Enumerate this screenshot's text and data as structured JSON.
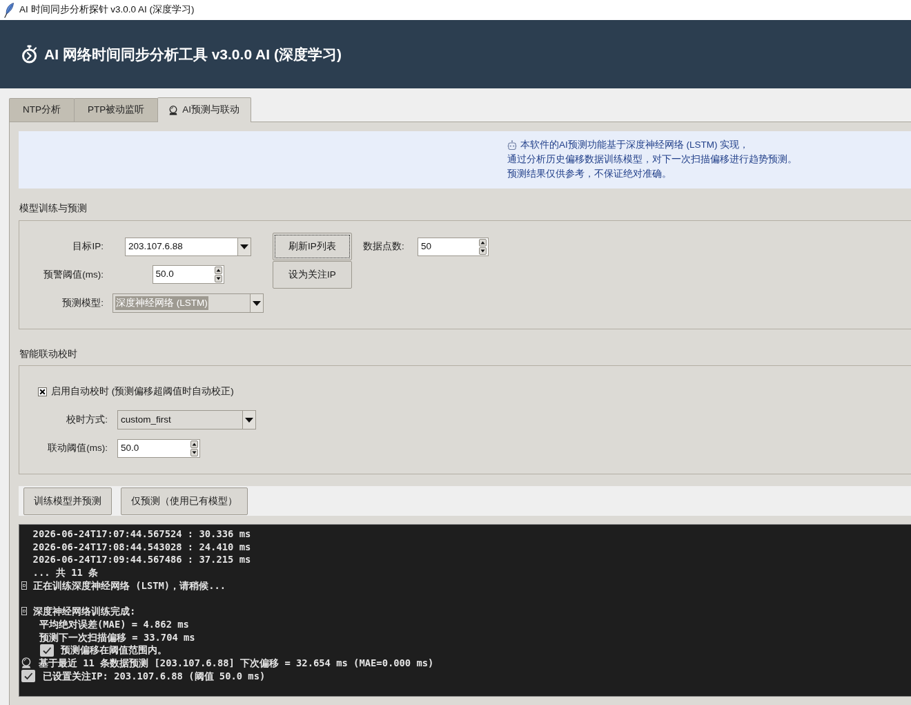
{
  "window": {
    "title": "AI 时间同步分析探针 v3.0.0 AI (深度学习)"
  },
  "header": {
    "title": "AI 网络时间同步分析工具 v3.0.0 AI (深度学习)"
  },
  "tabs": [
    {
      "label": "NTP分析",
      "kind": "plain",
      "selected": false
    },
    {
      "label": "PTP被动监听",
      "kind": "plain",
      "selected": false
    },
    {
      "label": "AI预测与联动",
      "kind": "forecast",
      "selected": true
    }
  ],
  "notice": {
    "lines": [
      "本软件的AI预测功能基于深度神经网络 (LSTM) 实现，",
      "通过分析历史偏移数据训练模型，对下一次扫描偏移进行趋势预测。",
      "预测结果仅供参考，不保证绝对准确。"
    ]
  },
  "model_section": {
    "title": "模型训练与预测",
    "target_ip": {
      "label": "目标IP:",
      "value": "203.107.6.88",
      "editable": true,
      "highlighted": false
    },
    "buttons": [
      {
        "label": "刷新IP列表",
        "focused": true
      },
      {
        "label": "设为关注IP",
        "focused": false
      }
    ],
    "data_points": {
      "label": "数据点数:",
      "value": "50"
    },
    "alert_threshold": {
      "label": "预警阈值(ms):",
      "value": "50.0"
    },
    "model": {
      "label": "预测模型:",
      "value": "深度神经网络 (LSTM)",
      "editable": false,
      "highlighted": true
    }
  },
  "sync_section": {
    "title": "智能联动校时",
    "auto_sync": {
      "label": "启用自动校时 (预测偏移超阈值时自动校正)",
      "checked": true
    },
    "mode": {
      "label": "校时方式:",
      "value": "custom_first",
      "editable": false,
      "highlighted": false
    },
    "threshold": {
      "label": "联动阈值(ms):",
      "value": "50.0"
    }
  },
  "actions": [
    {
      "label": "训练模型并预测"
    },
    {
      "label": "仅预测（使用已有模型）"
    }
  ],
  "console": {
    "lines": [
      {
        "kind": "sample",
        "text": "2026-06-24T17:07:44.567524 : 30.336 ms"
      },
      {
        "kind": "sample",
        "text": "2026-06-24T17:08:44.543028 : 24.410 ms"
      },
      {
        "kind": "sample",
        "text": "2026-06-24T17:09:44.567486 : 37.215 ms"
      },
      {
        "kind": "sample",
        "text": "... 共 11 条"
      },
      {
        "kind": "notice",
        "text": "正在训练深度神经网络 (LSTM)，请稍候..."
      },
      {
        "kind": "blank"
      },
      {
        "kind": "notice",
        "text": "深度神经网络训练完成:",
        "children": [
          {
            "kind": "plain",
            "text": "平均绝对误差(MAE) = 4.862 ms"
          },
          {
            "kind": "plain",
            "text": "预测下一次扫描偏移 = 33.704 ms"
          },
          {
            "kind": "check",
            "text": "预测偏移在阈值范围内。"
          }
        ]
      },
      {
        "kind": "forecast",
        "text": "基于最近 11 条数据预测 [203.107.6.88] 下次偏移 = 32.654 ms (MAE=0.000 ms)"
      },
      {
        "kind": "check",
        "text": "已设置关注IP: 203.107.6.88 (阈值 50.0 ms)"
      }
    ]
  }
}
